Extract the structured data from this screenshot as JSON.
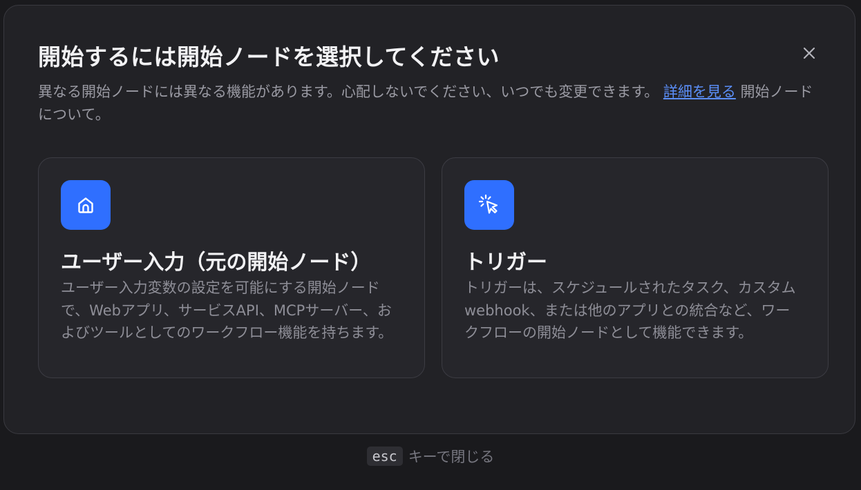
{
  "modal": {
    "title": "開始するには開始ノードを選択してください",
    "description_before_link": "異なる開始ノードには異なる機能があります。心配しないでください、いつでも変更できます。",
    "link_text": "詳細を見る",
    "description_after_link": "開始ノードについて。",
    "close_icon": "close-icon"
  },
  "cards": [
    {
      "icon": "home-icon",
      "title": "ユーザー入力（元の開始ノード）",
      "description": "ユーザー入力変数の設定を可能にする開始ノードで、Webアプリ、サービスAPI、MCPサーバー、およびツールとしてのワークフロー機能を持ちます。"
    },
    {
      "icon": "cursor-click-icon",
      "title": "トリガー",
      "description": "トリガーは、スケジュールされたタスク、カスタムwebhook、または他のアプリとの統合など、ワークフローの開始ノードとして機能できます。"
    }
  ],
  "footer": {
    "key": "esc",
    "text": "キーで閉じる"
  },
  "colors": {
    "accent": "#2f6fff",
    "link": "#5b8ff9",
    "modal_background": "#222226",
    "page_background": "#1a1a1d"
  }
}
